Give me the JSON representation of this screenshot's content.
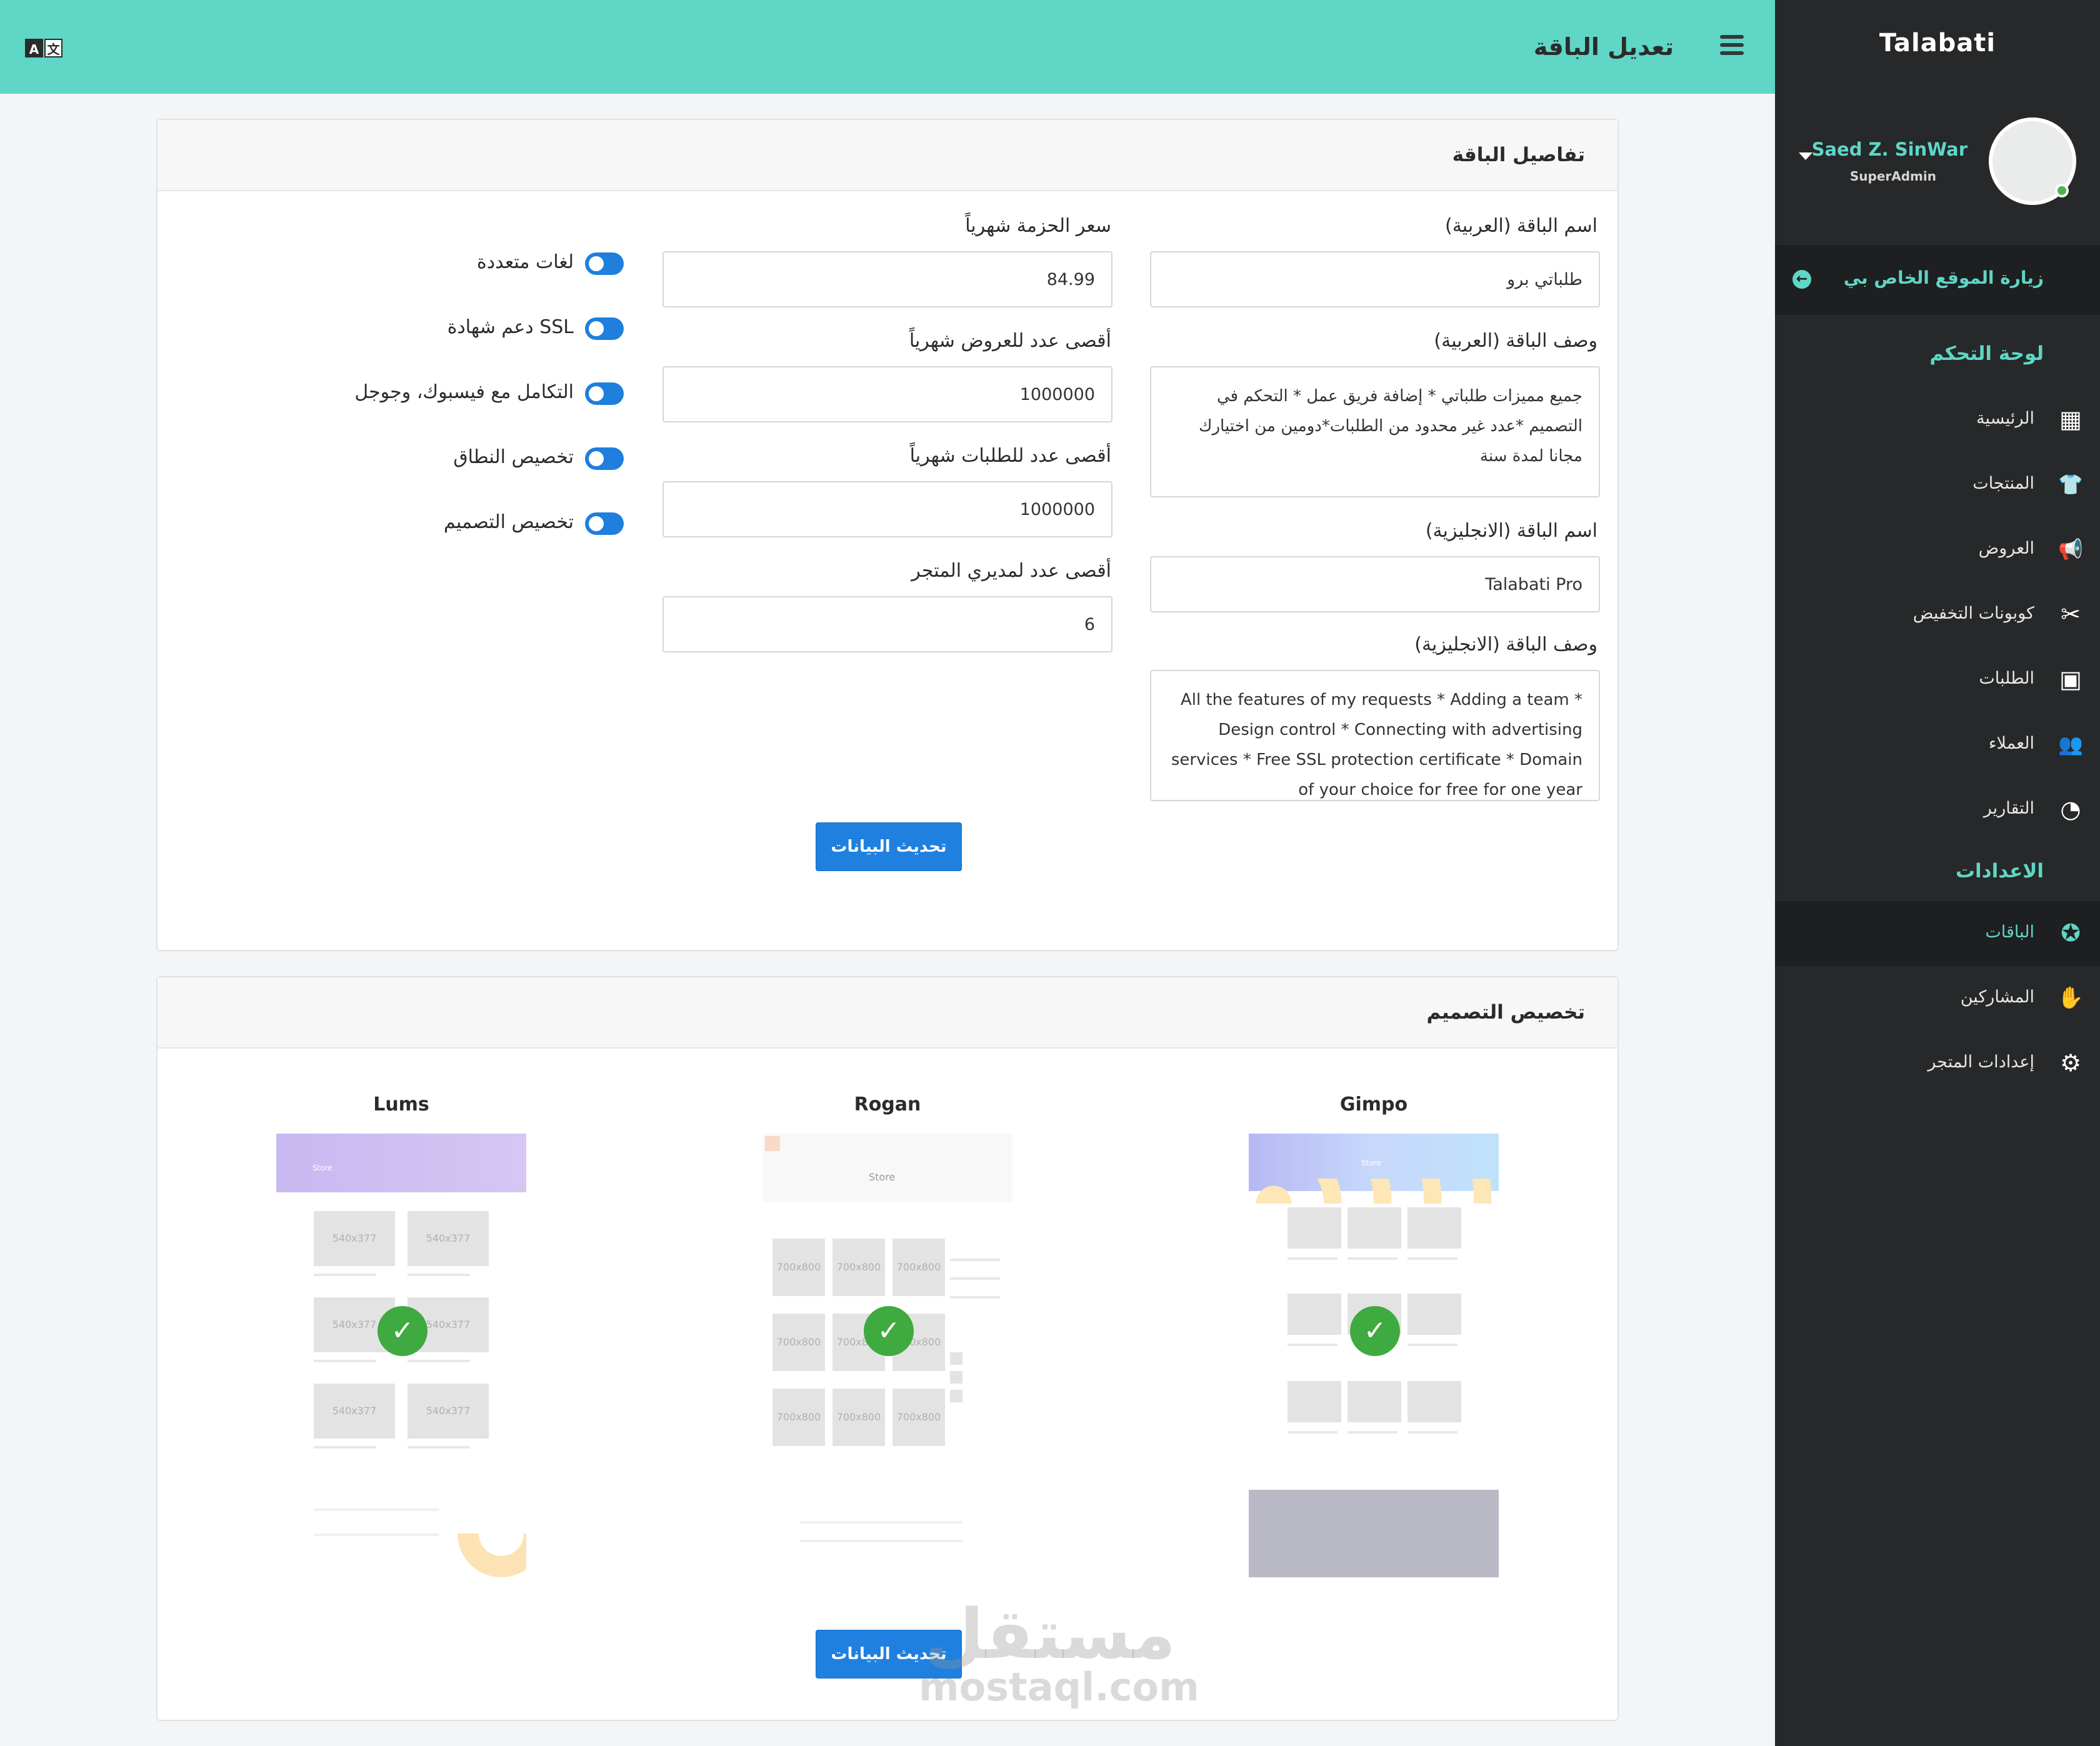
{
  "header": {
    "title": "تعديل الباقة",
    "lang_glyphs": [
      "A",
      "文"
    ]
  },
  "sidebar": {
    "brand": "Talabati",
    "user": {
      "name": "Saed Z. SinWar",
      "role": "SuperAdmin"
    },
    "visit_site": "زيارة الموقع الخاص بي",
    "section_dashboard": "لوحة التحكم",
    "section_settings": "الاعدادات",
    "items": [
      {
        "label": "الرئيسية",
        "icon": "dashboard-icon",
        "glyph": "▦"
      },
      {
        "label": "المنتجات",
        "icon": "tshirt-icon",
        "glyph": "👕"
      },
      {
        "label": "العروض",
        "icon": "megaphone-icon",
        "glyph": "📢"
      },
      {
        "label": "كوبونات التخفيض",
        "icon": "scissors-icon",
        "glyph": "✂"
      },
      {
        "label": "الطلبات",
        "icon": "box-icon",
        "glyph": "▣"
      },
      {
        "label": "العملاء",
        "icon": "users-icon",
        "glyph": "👥"
      },
      {
        "label": "التقارير",
        "icon": "pie-chart-icon",
        "glyph": "◔"
      }
    ],
    "settings_items": [
      {
        "label": "الباقات",
        "icon": "award-icon",
        "glyph": "✪"
      },
      {
        "label": "المشاركين",
        "icon": "hand-icon",
        "glyph": "✋"
      },
      {
        "label": "إعدادات المتجر",
        "icon": "gear-icon",
        "glyph": "⚙"
      }
    ]
  },
  "details": {
    "title": "تفاصيل الباقة",
    "name_ar_label": "اسم الباقة (العربية)",
    "name_ar_value": "طلباتي برو",
    "desc_ar_label": "وصف الباقة (العربية)",
    "desc_ar_value": "جميع مميزات طلباتي * إضافة فريق عمل * التحكم في التصميم *عدد غير محدود من الطلبات*دومين من اختيارك مجانا لمدة سنة",
    "name_en_label": "اسم الباقة (الانجليزية)",
    "name_en_value": "Talabati Pro",
    "desc_en_label": "وصف الباقة (الانجليزية)",
    "desc_en_value": "All the features of my requests * Adding a team * Design control * Connecting with advertising services * Free SSL protection certificate * Domain of your choice for free for one year",
    "price_label": "سعر الحزمة شهرياً",
    "price_value": "84.99",
    "max_offers_label": "أقصى عدد للعروض شهرياً",
    "max_offers_value": "1000000",
    "max_orders_label": "أقصى عدد للطلبات شهرياً",
    "max_orders_value": "1000000",
    "max_managers_label": "أقصى عدد لمديري المتجر",
    "max_managers_value": "6",
    "toggles": [
      {
        "label": "لغات متعددة",
        "on": true
      },
      {
        "label": "دعم شهادة SSL",
        "on": true
      },
      {
        "label": "التكامل مع فيسبوك، وجوجل",
        "on": true
      },
      {
        "label": "تخصيص النطاق",
        "on": true
      },
      {
        "label": "تخصيص التصميم",
        "on": true
      }
    ],
    "submit_label": "تحديث البيانات"
  },
  "design": {
    "title": "تخصيص التصميم",
    "templates": [
      {
        "name": "Gimpo",
        "selected": true,
        "placeholder": "",
        "hero_text": "Store"
      },
      {
        "name": "Rogan",
        "selected": true,
        "placeholder": "700x800",
        "hero_text": "Store"
      },
      {
        "name": "Lums",
        "selected": true,
        "placeholder": "540x377",
        "hero_text": "Store"
      }
    ],
    "submit_label": "تحديث البيانات"
  },
  "watermark": {
    "ar": "مستقل",
    "en": "mostaql.com"
  },
  "colors": {
    "accent": "#5fd6c6",
    "sidebar": "#262829",
    "primary_button": "#1f80e0",
    "check": "#3faa3f"
  }
}
